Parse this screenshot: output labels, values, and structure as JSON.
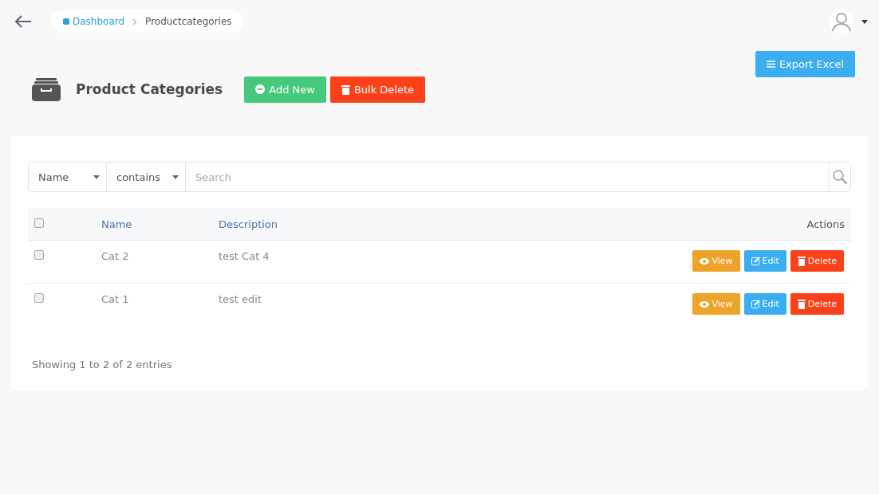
{
  "breadcrumb": [
    {
      "label": "Dashboard",
      "kind": "link"
    },
    {
      "label": "Productcategories",
      "kind": "current"
    }
  ],
  "page": {
    "title": "Product Categories"
  },
  "header_buttons": [
    {
      "label": "Add New",
      "kind": "add"
    },
    {
      "label": "Bulk Delete",
      "kind": "delete"
    }
  ],
  "export_button": {
    "label": "Export Excel"
  },
  "filter": {
    "field": "Name",
    "operator": "contains",
    "placeholder": "Search"
  },
  "table": {
    "select_all": {
      "checked": false
    },
    "columns": [
      "Name",
      "Description",
      "Actions"
    ],
    "rows": [
      {
        "checked": false,
        "name": "Cat 2",
        "description": "test Cat 4",
        "actions": [
          {
            "label": "View",
            "kind": "view"
          },
          {
            "label": "Edit",
            "kind": "edit"
          },
          {
            "label": "Delete",
            "kind": "delete"
          }
        ]
      },
      {
        "checked": false,
        "name": "Cat 1",
        "description": "test edit",
        "actions": [
          {
            "label": "View",
            "kind": "view"
          },
          {
            "label": "Edit",
            "kind": "edit"
          },
          {
            "label": "Delete",
            "kind": "delete"
          }
        ]
      }
    ]
  },
  "footer": "Showing 1 to 2 of 2 entries"
}
